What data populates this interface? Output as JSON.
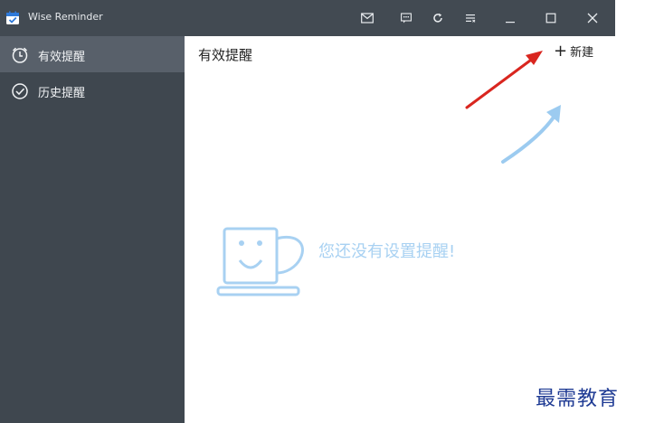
{
  "window": {
    "title": "Wise Reminder"
  },
  "titlebar": {
    "buttons": [
      "mail-icon",
      "message-icon",
      "refresh-icon",
      "menu-icon",
      "minimize-icon",
      "maximize-icon",
      "close-icon"
    ]
  },
  "sidebar": {
    "items": [
      {
        "label": "有效提醒",
        "icon": "alarm-clock-icon",
        "active": true
      },
      {
        "label": "历史提醒",
        "icon": "check-circle-icon",
        "active": false
      }
    ]
  },
  "main": {
    "title": "有效提醒",
    "new_button": {
      "plus": "+",
      "label": "新建"
    },
    "empty_state": {
      "text": "您还没有设置提醒!",
      "icon": "coffee-cup-icon"
    }
  },
  "annotations": {
    "arrow_colors": [
      "#d9261f",
      "#9ccbf0"
    ]
  },
  "watermark": {
    "text": "最需教育"
  },
  "colors": {
    "titlebar": "#424a52",
    "sidebar": "#3f474f",
    "sidebar_active": "#58606a",
    "empty_accent": "#a8d1f2"
  }
}
